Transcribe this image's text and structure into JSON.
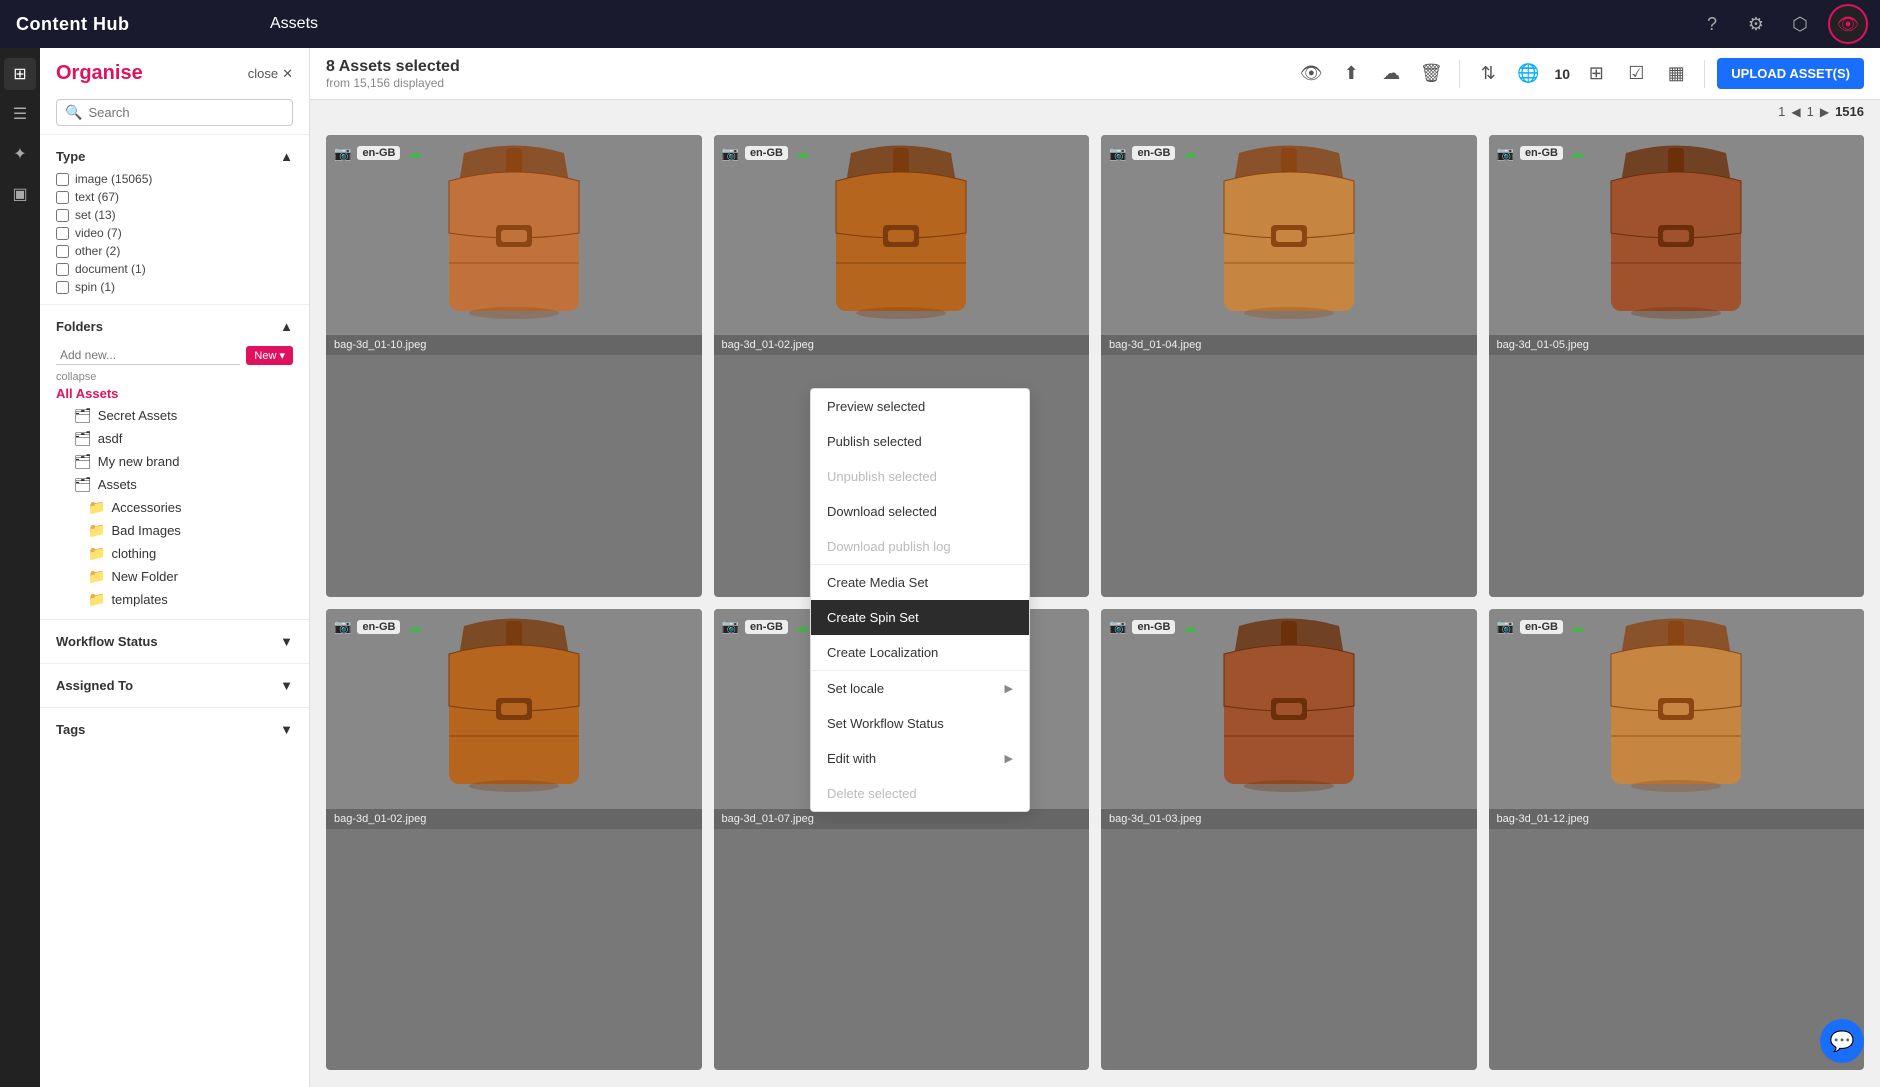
{
  "app": {
    "logo": "Content Hub",
    "page_title": "Assets"
  },
  "topnav": {
    "icons": [
      "help-icon",
      "settings-icon",
      "export-icon",
      "user-avatar"
    ]
  },
  "leftnav": {
    "items": [
      {
        "name": "grid-icon",
        "label": "Grid"
      },
      {
        "name": "filter-icon",
        "label": "Filter"
      },
      {
        "name": "tools-icon",
        "label": "Tools"
      },
      {
        "name": "box-icon",
        "label": "Box"
      }
    ]
  },
  "organise": {
    "title": "Organise",
    "close_label": "close",
    "search_placeholder": "Search"
  },
  "type_filter": {
    "header": "Type",
    "items": [
      {
        "label": "image (15065)",
        "checked": false
      },
      {
        "label": "text (67)",
        "checked": false
      },
      {
        "label": "set (13)",
        "checked": false
      },
      {
        "label": "video (7)",
        "checked": false
      },
      {
        "label": "other (2)",
        "checked": false
      },
      {
        "label": "document (1)",
        "checked": false
      },
      {
        "label": "spin (1)",
        "checked": false
      }
    ]
  },
  "folders": {
    "header": "Folders",
    "add_placeholder": "Add new...",
    "new_label": "New ▾",
    "collapse_label": "collapse",
    "all_assets_label": "All Assets",
    "items": [
      {
        "label": "Secret Assets",
        "icon": "🗂",
        "level": "sub"
      },
      {
        "label": "asdf",
        "icon": "🗂",
        "level": "sub"
      },
      {
        "label": "My new brand",
        "icon": "🗂",
        "level": "sub"
      },
      {
        "label": "Assets",
        "icon": "🗂",
        "level": "sub"
      },
      {
        "label": "Accessories",
        "icon": "📁",
        "level": "subsub"
      },
      {
        "label": "Bad Images",
        "icon": "📁",
        "level": "subsub"
      },
      {
        "label": "clothing",
        "icon": "📁",
        "level": "subsub"
      },
      {
        "label": "New Folder",
        "icon": "📁",
        "level": "subsub"
      },
      {
        "label": "templates",
        "icon": "📁",
        "level": "subsub"
      }
    ]
  },
  "workflow_status": {
    "header": "Workflow Status"
  },
  "assigned_to": {
    "header": "Assigned To"
  },
  "tags": {
    "header": "Tags"
  },
  "toolbar": {
    "selection_count": "8 Assets selected",
    "selection_sub": "from 15,156 displayed",
    "upload_label": "UPLOAD ASSET(S)",
    "page_num": "10",
    "current_page": "1",
    "total_pages": "1516"
  },
  "context_menu": {
    "items": [
      {
        "label": "Preview selected",
        "disabled": false,
        "active": false,
        "arrow": false
      },
      {
        "label": "Publish selected",
        "disabled": false,
        "active": false,
        "arrow": false
      },
      {
        "label": "Unpublish selected",
        "disabled": true,
        "active": false,
        "arrow": false
      },
      {
        "label": "Download selected",
        "disabled": false,
        "active": false,
        "arrow": false
      },
      {
        "label": "Download publish log",
        "disabled": true,
        "active": false,
        "arrow": false
      },
      {
        "label": "Create Media Set",
        "disabled": false,
        "active": false,
        "arrow": false
      },
      {
        "label": "Create Spin Set",
        "disabled": false,
        "active": true,
        "arrow": false
      },
      {
        "label": "Create Localization",
        "disabled": false,
        "active": false,
        "arrow": false
      },
      {
        "label": "Set locale",
        "disabled": false,
        "active": false,
        "arrow": true
      },
      {
        "label": "Set Workflow Status",
        "disabled": false,
        "active": false,
        "arrow": false
      },
      {
        "label": "Edit with",
        "disabled": false,
        "active": false,
        "arrow": true
      },
      {
        "label": "Delete selected",
        "disabled": true,
        "active": false,
        "arrow": false
      }
    ]
  },
  "assets": [
    {
      "name": "bag-3d_01-10.jpeg",
      "locale": "en-GB"
    },
    {
      "name": "bag-3d_01-02.jpeg",
      "locale": "en-GB"
    },
    {
      "name": "bag-3d_01-04.jpeg",
      "locale": "en-GB"
    },
    {
      "name": "bag-3d_01-05.jpeg",
      "locale": "en-GB"
    },
    {
      "name": "bag-3d_01-02.jpeg",
      "locale": "en-GB"
    },
    {
      "name": "bag-3d_01-07.jpeg",
      "locale": "en-GB"
    },
    {
      "name": "bag-3d_01-03.jpeg",
      "locale": "en-GB"
    },
    {
      "name": "bag-3d_01-12.jpeg",
      "locale": "en-GB"
    }
  ]
}
